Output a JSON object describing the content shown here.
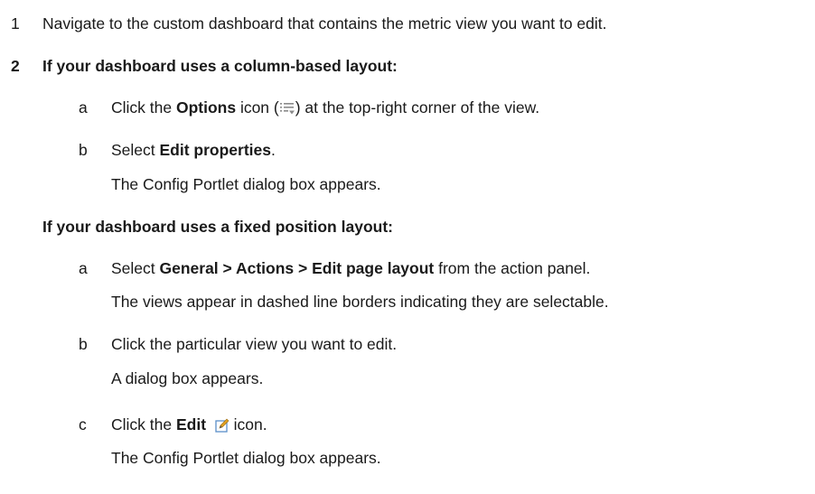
{
  "procedure": {
    "step1": {
      "number": "1",
      "text": "Navigate to the custom dashboard that contains the metric view you want to edit."
    },
    "step2": {
      "number": "2",
      "column_heading": "If your dashboard uses a column-based layout:",
      "column_steps": {
        "a": {
          "letter": "a",
          "pre": "Click the ",
          "bold": "Options",
          "mid": " icon (",
          "icon": "options-icon",
          "post": ") at the top-right corner of the view."
        },
        "b": {
          "letter": "b",
          "pre": "Select ",
          "bold": "Edit properties",
          "post": ".",
          "result": "The Config Portlet dialog box appears."
        }
      },
      "fixed_heading": "If your dashboard uses a fixed position layout:",
      "fixed_steps": {
        "a": {
          "letter": "a",
          "pre": "Select ",
          "bold": "General > Actions > Edit page layout",
          "post": " from the action panel.",
          "result": "The views appear in dashed line borders indicating they are selectable."
        },
        "b": {
          "letter": "b",
          "text": "Click the particular view you want to edit.",
          "result": "A dialog box appears."
        },
        "c": {
          "letter": "c",
          "pre": "Click the ",
          "bold": "Edit",
          "icon": "edit-icon",
          "post": " icon.",
          "result": "The Config Portlet dialog box appears."
        }
      }
    }
  },
  "colors": {
    "text": "#1a1a1a",
    "options_icon": "#8a8a8a",
    "edit_icon_border": "#5a8fc8",
    "edit_icon_pencil": "#e0a020"
  }
}
